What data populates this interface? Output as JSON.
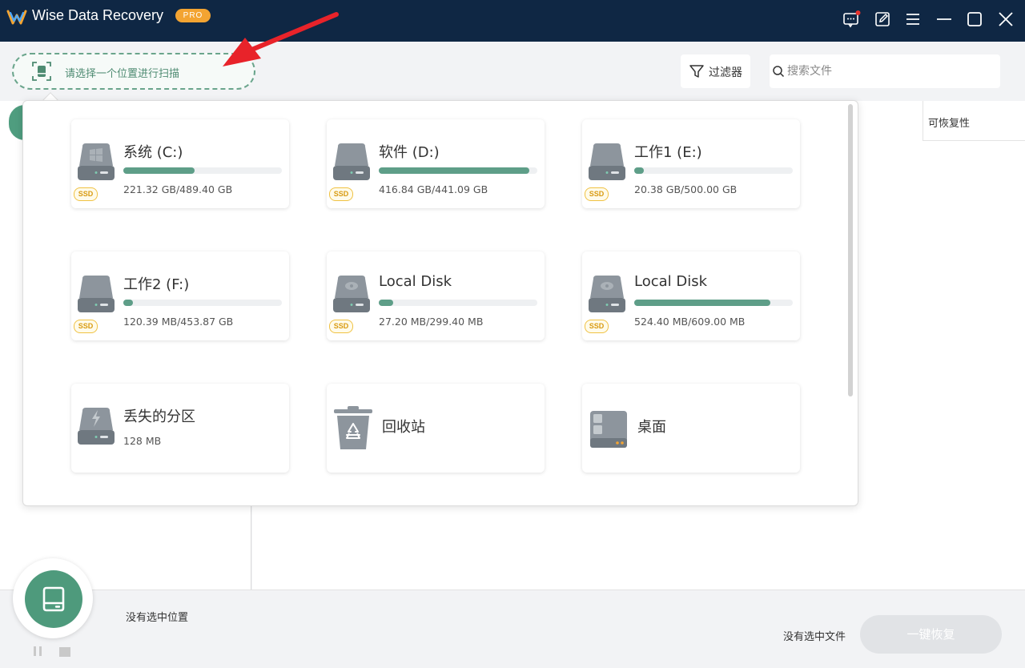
{
  "app": {
    "title": "Wise Data Recovery",
    "badge": "PRO"
  },
  "titlebar_icons": [
    "feedback-icon",
    "edit-icon",
    "menu-icon",
    "minimize-icon",
    "maximize-icon",
    "close-icon"
  ],
  "toolbar": {
    "scan_location_label": "请选择一个位置进行扫描",
    "filter_label": "过滤器",
    "search_placeholder": "搜索文件"
  },
  "table": {
    "recoverability_header": "可恢复性"
  },
  "drives": [
    {
      "name": "系统 (C:)",
      "size": "221.32 GB/489.40 GB",
      "usage": 0.45,
      "ssd": "SSD",
      "icon": "windows-drive-icon"
    },
    {
      "name": "软件 (D:)",
      "size": "416.84 GB/441.09 GB",
      "usage": 0.95,
      "ssd": "SSD",
      "icon": "drive-icon"
    },
    {
      "name": "工作1 (E:)",
      "size": "20.38 GB/500.00 GB",
      "usage": 0.06,
      "ssd": "SSD",
      "icon": "drive-icon"
    },
    {
      "name": "工作2 (F:)",
      "size": "120.39 MB/453.87 GB",
      "usage": 0.06,
      "ssd": "SSD",
      "icon": "drive-icon"
    },
    {
      "name": "Local Disk",
      "size": "27.20 MB/299.40 MB",
      "usage": 0.09,
      "ssd": "SSD",
      "icon": "local-disk-icon"
    },
    {
      "name": "Local Disk",
      "size": "524.40 MB/609.00 MB",
      "usage": 0.86,
      "ssd": "SSD",
      "icon": "local-disk-icon"
    }
  ],
  "lost_partition": {
    "name": "丢失的分区",
    "size": "128 MB"
  },
  "recycle_bin": {
    "name": "回收站"
  },
  "desktop": {
    "name": "桌面"
  },
  "footer": {
    "no_location": "没有选中位置",
    "no_file": "没有选中文件",
    "recover_button": "一键恢复"
  },
  "colors": {
    "titlebar": "#0f2744",
    "accent_green": "#4e9a7c",
    "pro_badge": "#f3a432",
    "ssd_badge": "#f0c243",
    "annotation_arrow": "#e8232a"
  }
}
